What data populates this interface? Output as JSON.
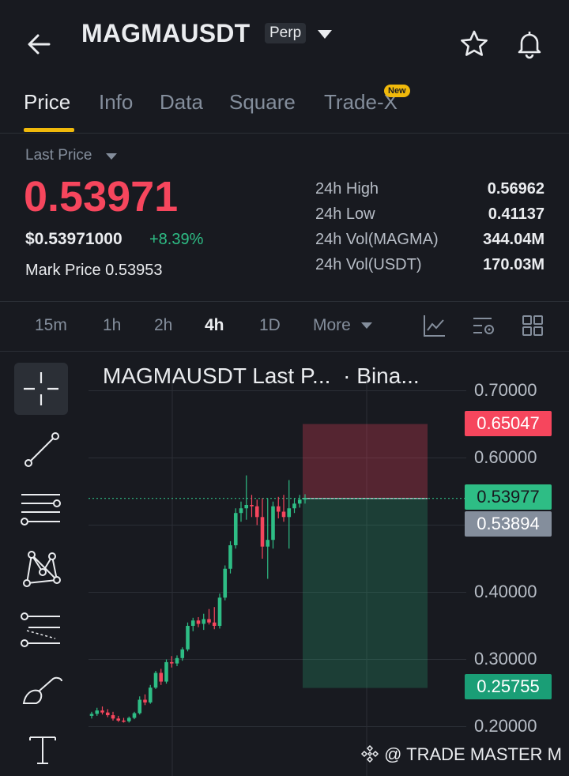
{
  "header": {
    "symbol": "MAGMAUSDT",
    "badge": "Perp",
    "icons": [
      "back-arrow-icon",
      "caret-down-icon",
      "star-icon",
      "bell-icon"
    ]
  },
  "tabs": [
    {
      "label": "Price",
      "active": true
    },
    {
      "label": "Info",
      "active": false
    },
    {
      "label": "Data",
      "active": false
    },
    {
      "label": "Square",
      "active": false
    },
    {
      "label": "Trade-X",
      "active": false,
      "badge": "New"
    }
  ],
  "ticker": {
    "last_price_label": "Last Price",
    "last_price": "0.53971",
    "usd_price": "$0.53971000",
    "change": "+8.39%",
    "mark_price_label": "Mark Price",
    "mark_price": "0.53953",
    "stats": [
      {
        "label": "24h High",
        "value": "0.56962"
      },
      {
        "label": "24h Low",
        "value": "0.41137"
      },
      {
        "label": "24h Vol(MAGMA)",
        "value": "344.04M"
      },
      {
        "label": "24h Vol(USDT)",
        "value": "170.03M"
      }
    ]
  },
  "timeframes": [
    {
      "label": "15m",
      "active": false
    },
    {
      "label": "1h",
      "active": false
    },
    {
      "label": "2h",
      "active": false
    },
    {
      "label": "4h",
      "active": true
    },
    {
      "label": "1D",
      "active": false
    },
    {
      "label": "More",
      "active": false
    }
  ],
  "chart_tools": [
    "indicator-icon",
    "settings-icon",
    "layout-grid-icon"
  ],
  "drawing_tools": [
    "crosshair-icon",
    "trendline-icon",
    "fib-levels-icon",
    "pattern-icon",
    "projection-icon",
    "brush-icon",
    "text-icon"
  ],
  "chart": {
    "title": "MAGMAUSDT Last P...",
    "source": "· Bina...",
    "y_axis_labels": [
      "0.70000",
      "0.60000",
      "0.40000",
      "0.30000",
      "0.20000"
    ],
    "tags": {
      "stop": "0.65047",
      "last": "0.53977",
      "mark": "0.53894",
      "target": "0.25755"
    },
    "colors": {
      "up": "#2ebd85",
      "down": "#f6465d",
      "accent": "#f0b90b"
    }
  },
  "chart_data": {
    "type": "candlestick",
    "ylim": [
      0.18,
      0.73
    ],
    "y_ticks": [
      0.7,
      0.6,
      0.4,
      0.3,
      0.2
    ],
    "candles": [
      {
        "o": 0.216,
        "h": 0.222,
        "l": 0.212,
        "c": 0.219
      },
      {
        "o": 0.219,
        "h": 0.228,
        "l": 0.216,
        "c": 0.224
      },
      {
        "o": 0.224,
        "h": 0.23,
        "l": 0.218,
        "c": 0.221
      },
      {
        "o": 0.221,
        "h": 0.226,
        "l": 0.214,
        "c": 0.217
      },
      {
        "o": 0.217,
        "h": 0.222,
        "l": 0.209,
        "c": 0.212
      },
      {
        "o": 0.212,
        "h": 0.216,
        "l": 0.207,
        "c": 0.209
      },
      {
        "o": 0.209,
        "h": 0.213,
        "l": 0.206,
        "c": 0.208
      },
      {
        "o": 0.208,
        "h": 0.215,
        "l": 0.206,
        "c": 0.213
      },
      {
        "o": 0.213,
        "h": 0.222,
        "l": 0.211,
        "c": 0.22
      },
      {
        "o": 0.22,
        "h": 0.245,
        "l": 0.218,
        "c": 0.24
      },
      {
        "o": 0.24,
        "h": 0.248,
        "l": 0.232,
        "c": 0.236
      },
      {
        "o": 0.236,
        "h": 0.262,
        "l": 0.234,
        "c": 0.258
      },
      {
        "o": 0.258,
        "h": 0.283,
        "l": 0.256,
        "c": 0.28
      },
      {
        "o": 0.28,
        "h": 0.286,
        "l": 0.262,
        "c": 0.267
      },
      {
        "o": 0.267,
        "h": 0.3,
        "l": 0.264,
        "c": 0.296
      },
      {
        "o": 0.296,
        "h": 0.305,
        "l": 0.288,
        "c": 0.294
      },
      {
        "o": 0.294,
        "h": 0.306,
        "l": 0.29,
        "c": 0.302
      },
      {
        "o": 0.302,
        "h": 0.318,
        "l": 0.298,
        "c": 0.315
      },
      {
        "o": 0.315,
        "h": 0.355,
        "l": 0.312,
        "c": 0.35
      },
      {
        "o": 0.35,
        "h": 0.362,
        "l": 0.342,
        "c": 0.358
      },
      {
        "o": 0.358,
        "h": 0.363,
        "l": 0.348,
        "c": 0.353
      },
      {
        "o": 0.353,
        "h": 0.368,
        "l": 0.344,
        "c": 0.36
      },
      {
        "o": 0.36,
        "h": 0.375,
        "l": 0.352,
        "c": 0.355
      },
      {
        "o": 0.355,
        "h": 0.378,
        "l": 0.345,
        "c": 0.35
      },
      {
        "o": 0.35,
        "h": 0.398,
        "l": 0.346,
        "c": 0.392
      },
      {
        "o": 0.392,
        "h": 0.44,
        "l": 0.388,
        "c": 0.435
      },
      {
        "o": 0.435,
        "h": 0.476,
        "l": 0.428,
        "c": 0.47
      },
      {
        "o": 0.47,
        "h": 0.525,
        "l": 0.465,
        "c": 0.518
      },
      {
        "o": 0.518,
        "h": 0.535,
        "l": 0.505,
        "c": 0.525
      },
      {
        "o": 0.525,
        "h": 0.574,
        "l": 0.508,
        "c": 0.53
      },
      {
        "o": 0.53,
        "h": 0.545,
        "l": 0.512,
        "c": 0.528
      },
      {
        "o": 0.528,
        "h": 0.538,
        "l": 0.5,
        "c": 0.512
      },
      {
        "o": 0.512,
        "h": 0.54,
        "l": 0.45,
        "c": 0.468
      },
      {
        "o": 0.468,
        "h": 0.54,
        "l": 0.42,
        "c": 0.478
      },
      {
        "o": 0.478,
        "h": 0.535,
        "l": 0.465,
        "c": 0.528
      },
      {
        "o": 0.528,
        "h": 0.542,
        "l": 0.51,
        "c": 0.52
      },
      {
        "o": 0.52,
        "h": 0.545,
        "l": 0.505,
        "c": 0.512
      },
      {
        "o": 0.512,
        "h": 0.567,
        "l": 0.465,
        "c": 0.525
      },
      {
        "o": 0.525,
        "h": 0.54,
        "l": 0.518,
        "c": 0.532
      },
      {
        "o": 0.532,
        "h": 0.545,
        "l": 0.526,
        "c": 0.538
      },
      {
        "o": 0.538,
        "h": 0.546,
        "l": 0.532,
        "c": 0.54
      }
    ],
    "position": {
      "entry": 0.53977,
      "stop": 0.65047,
      "target": 0.25755
    }
  },
  "watermark": "@ TRADE MASTER M"
}
